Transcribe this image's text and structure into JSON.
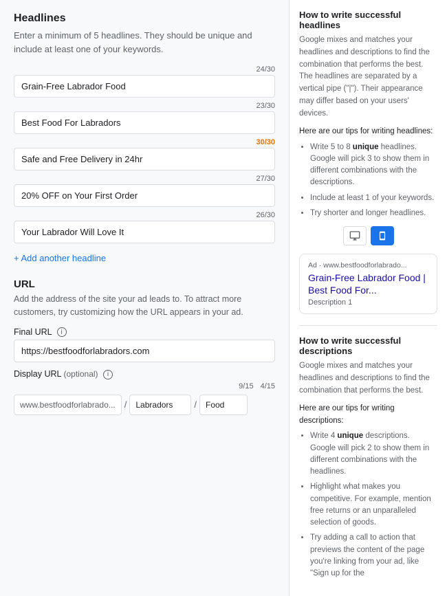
{
  "headlines_section": {
    "title": "Headlines",
    "description": "Enter a minimum of 5 headlines. They should be unique and include at least one of your keywords.",
    "fields": [
      {
        "id": "h1",
        "value": "Grain-Free Labrador Food",
        "count": "24/30",
        "over_limit": false
      },
      {
        "id": "h2",
        "value": "Best Food For Labradors",
        "count": "23/30",
        "over_limit": false
      },
      {
        "id": "h3",
        "value": "Safe and Free Delivery in 24hr",
        "count": "30/30",
        "over_limit": true
      },
      {
        "id": "h4",
        "value": "20% OFF on Your First Order",
        "count": "27/30",
        "over_limit": false
      },
      {
        "id": "h5",
        "value": "Your Labrador Will Love It",
        "count": "26/30",
        "over_limit": false
      }
    ],
    "add_link": "+ Add another headline"
  },
  "url_section": {
    "title": "URL",
    "description": "Add the address of the site your ad leads to. To attract more customers, try customizing how the URL appears in your ad.",
    "final_url_label": "Final URL",
    "final_url_info": "i",
    "final_url_value": "https://bestfoodforlabradors.com",
    "final_url_placeholder": "",
    "display_url_label": "Display URL",
    "display_url_optional": "(optional)",
    "display_url_info": "i",
    "display_url_base": "www.bestfoodforlabrado...",
    "display_url_part1_count": "9/15",
    "display_url_part2_count": "4/15",
    "display_url_part1_value": "Labradors",
    "display_url_part2_value": "Food"
  },
  "right_panel": {
    "headlines_tips_title": "How to write successful headlines",
    "headlines_tips_intro": "Google mixes and matches your headlines and descriptions to find the combination that performs the best. The headlines are separated by a vertical pipe (\"|\"). Their appearance may differ based on your users' devices.",
    "headlines_tips_header": "Here are our tips for writing headlines:",
    "headlines_tips": [
      {
        "text": "Write 5 to 8 ",
        "bold": "unique",
        "text2": " headlines. Google will pick 3 to show them in different combinations with the descriptions."
      },
      {
        "text": "Include at least 1 of your keywords."
      },
      {
        "text": "Try shorter and longer headlines."
      }
    ],
    "device_desktop_label": "desktop",
    "device_mobile_label": "mobile",
    "ad_preview": {
      "label": "Ad · www.bestfoodforlabrado...",
      "headline": "Grain-Free Labrador Food | Best Food For...",
      "description": "Description 1"
    },
    "descriptions_tips_title": "How to write successful descriptions",
    "descriptions_tips_intro": "Google mixes and matches your headlines and descriptions to find the combination that performs the best.",
    "descriptions_tips_header": "Here are our tips for writing descriptions:",
    "descriptions_tips": [
      {
        "text": "Write 4 ",
        "bold": "unique",
        "text2": " descriptions. Google will pick 2 to show them in different combinations with the headlines."
      },
      {
        "text": "Highlight what makes you competitive. For example, mention free returns or an unparalleled selection of goods."
      },
      {
        "text": "Try adding a call to action that previews the content of the page you're linking from your ad, like \"Sign up for the"
      }
    ]
  }
}
